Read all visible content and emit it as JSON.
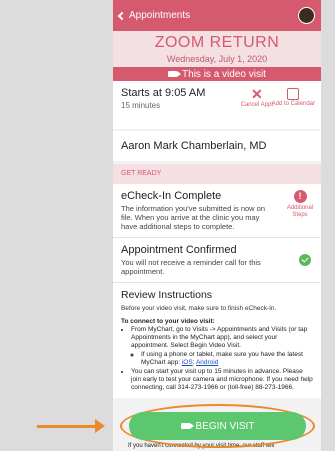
{
  "nav": {
    "back_label": "Appointments"
  },
  "appointment": {
    "title": "ZOOM RETURN",
    "date": "Wednesday, July 1, 2020",
    "video_banner": "This is a video visit"
  },
  "details": {
    "start": "Starts at 9:05 AM",
    "duration": "15 minutes",
    "cancel_label": "Cancel Appt",
    "add_calendar_label": "Add to Calendar",
    "provider": "Aaron Mark Chamberlain, MD"
  },
  "get_ready": {
    "header": "GET READY",
    "echeckin": {
      "title": "eCheck-In Complete",
      "text": "The information you've submitted is now on file. When you arrive at the clinic you may have additional steps to complete.",
      "badge": "Additional Steps"
    },
    "confirmed": {
      "title": "Appointment Confirmed",
      "text": "You will not receive a reminder call for this appointment."
    }
  },
  "review": {
    "title": "Review Instructions",
    "sub": "Before your video visit, make sure to finish eCheck-In.",
    "connect_header": "To connect to your video visit:",
    "bullet1": "From MyChart, go to Visits -> Appointments and Visits (or tap Appointments in the MyChart app), and select your appointment. Select Begin Video Visit.",
    "sub_bullet": "If using a phone or tablet, make sure you have the latest MyChart app:",
    "ios": "iOS",
    "android": "Android",
    "bullet2": "You can start your visit up to 15 minutes in advance. Please join early to test your camera and microphone. If you need help connecting, call 314-273-1966 or (toll-free) 88-273-1966.",
    "below_text": "If you haven't connected by your visit time, our staff will"
  },
  "begin_label": "BEGIN VISIT",
  "colors": {
    "brand": "#d65a6e",
    "begin": "#5cc76f",
    "highlight": "#e98a2c"
  }
}
